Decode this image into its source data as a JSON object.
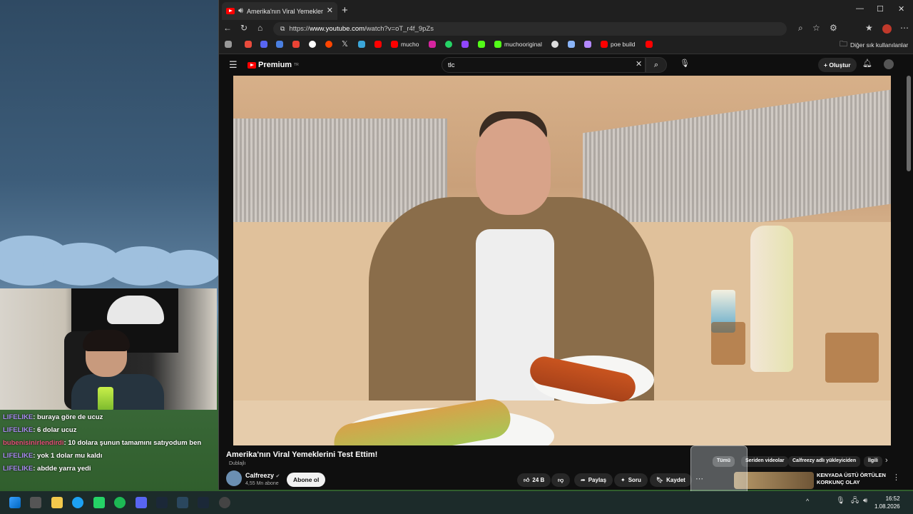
{
  "browser": {
    "tab_title": "Amerika'nın Viral Yemeklerini",
    "url_prefix": "https://",
    "url_host": "www.youtube.com",
    "url_path": "/watch?v=oT_r4f_9pZs",
    "bookmarks": [
      "mucho",
      "muchooriginal",
      "poe build"
    ],
    "other_bookmarks": "Diğer sık kullanılanlar"
  },
  "youtube": {
    "logo_text": "Premium",
    "logo_sup": "TR",
    "search_value": "tlc",
    "create_label": "Oluştur",
    "video_title": "Amerika'nın Viral Yemeklerini Test Ettim!",
    "dub_label": "Dublajlı",
    "channel_name": "Calfreezy",
    "subscribers": "4,55 Mn abone",
    "subscribe_label": "Abone ol",
    "likes": "24 B",
    "share_label": "Paylaş",
    "ask_label": "Soru",
    "save_label": "Kaydet",
    "chips": [
      "Tümü",
      "Seriden videolar",
      "Calfreezy adlı yükleyiciden",
      "İlgili"
    ],
    "suggested_title": "KENYADA ÜSTÜ ÖRTÜLEN KORKUNÇ OLAY"
  },
  "chat": [
    {
      "user": "LIFELIKE",
      "text": ": buraya göre de ucuz"
    },
    {
      "user": "LIFELIKE",
      "text": ": 6 dolar ucuz"
    },
    {
      "user": "bubenisinirlendirdi",
      "text": ": 10 dolara şunun tamamını satıyodum ben"
    },
    {
      "user": "LIFELIKE",
      "text": ": yok 1 dolar mu kaldı"
    },
    {
      "user": "LIFELIKE",
      "text": ": abdde yarra yedi"
    }
  ],
  "clock": {
    "time": "16:52",
    "date": "1.08.2026"
  }
}
